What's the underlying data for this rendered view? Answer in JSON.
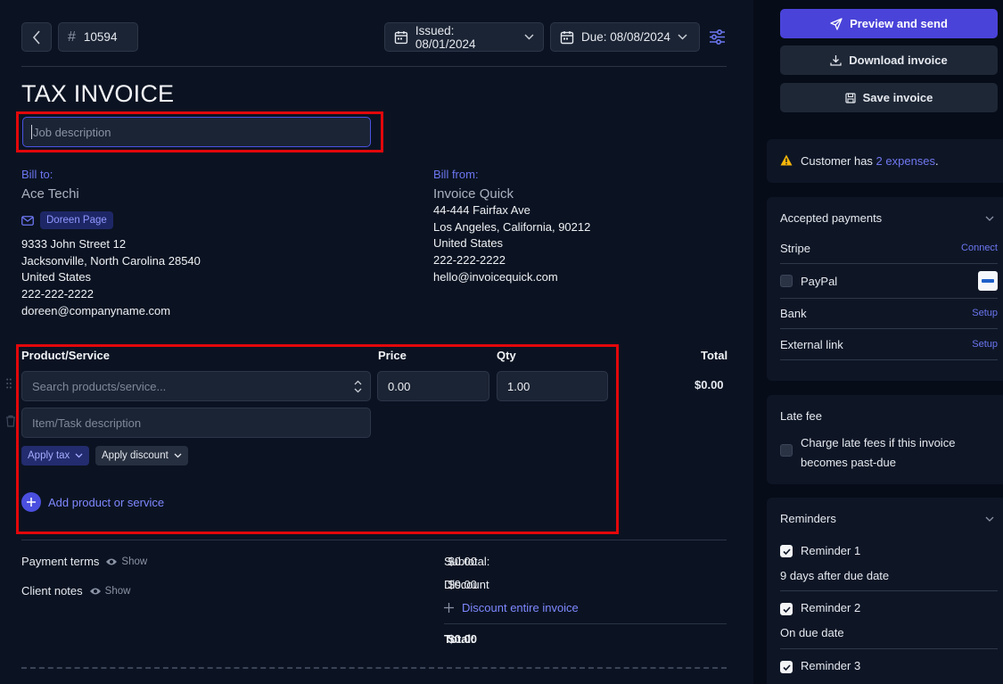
{
  "header": {
    "invoice_number": "10594",
    "issued_label": "Issued: 08/01/2024",
    "due_label": "Due: 08/08/2024"
  },
  "invoice": {
    "title": "TAX INVOICE",
    "job_placeholder": "Job description"
  },
  "bill_to": {
    "label": "Bill to:",
    "name": "Ace Techi",
    "contact_chip": "Doreen Page",
    "address_line1": "9333 John Street 12",
    "address_line2": "Jacksonville, North Carolina 28540",
    "country": "United States",
    "phone": "222-222-2222",
    "email": "doreen@companyname.com"
  },
  "bill_from": {
    "label": "Bill from:",
    "name": "Invoice Quick",
    "address_line1": "44-444 Fairfax Ave",
    "address_line2": "Los Angeles, California, 90212",
    "country": "United States",
    "phone": "222-222-2222",
    "email": "hello@invoicequick.com"
  },
  "items": {
    "col_product": "Product/Service",
    "col_price": "Price",
    "col_qty": "Qty",
    "col_total": "Total",
    "search_placeholder": "Search products/service...",
    "price_value": "0.00",
    "qty_value": "1.00",
    "row_total": "$0.00",
    "desc_placeholder": "Item/Task description",
    "apply_tax": "Apply tax",
    "apply_discount": "Apply discount",
    "add_label": "Add product or service"
  },
  "footer": {
    "payment_terms": "Payment terms",
    "client_notes": "Client notes",
    "show": "Show",
    "subtotal_label": "Subtotal:",
    "subtotal_value": "$0.00",
    "discount_label": "Discount",
    "discount_value": "$0.00",
    "discount_entire": "Discount entire invoice",
    "total_label": "Total:",
    "total_value": "$0.00"
  },
  "sidebar": {
    "preview_send": "Preview and send",
    "download": "Download invoice",
    "save": "Save invoice",
    "expenses_prefix": "Customer has ",
    "expenses_link": "2 expenses",
    "expenses_suffix": ".",
    "accepted_payments": "Accepted payments",
    "stripe": "Stripe",
    "connect": "Connect",
    "paypal": "PayPal",
    "bank": "Bank",
    "external_link": "External link",
    "setup": "Setup",
    "late_fee_title": "Late fee",
    "late_fee_line1": "Charge late fees if this invoice",
    "late_fee_line2": "becomes past-due",
    "reminders_title": "Reminders",
    "reminder1": "Reminder 1",
    "reminder1_desc": "9 days after due date",
    "reminder2": "Reminder 2",
    "reminder2_desc": "On due date",
    "reminder3": "Reminder 3"
  },
  "colors": {
    "accent": "#4a43d9",
    "link": "#6c76f0",
    "highlight": "#e2070b",
    "background": "#0b1322"
  }
}
